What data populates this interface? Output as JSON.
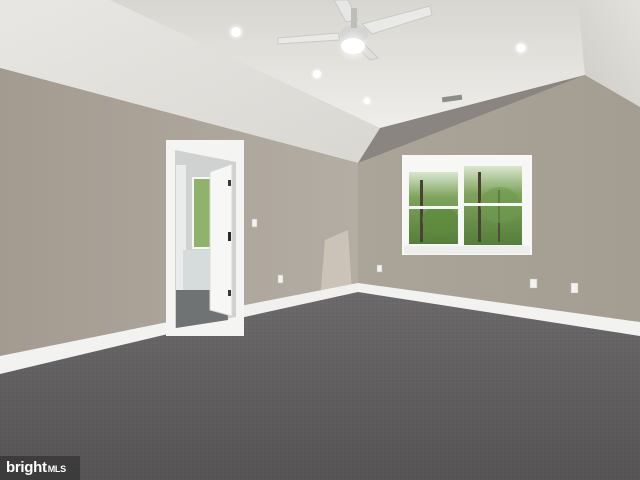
{
  "photo": {
    "subject": "empty room",
    "colors": {
      "wall_left": "#aea69c",
      "wall_right": "#a9a398",
      "ceiling": "#e4e2dd",
      "carpet": "#5e5c5d",
      "trim": "#f2f2f0",
      "window_view": "#6e9a4e"
    }
  },
  "watermark": {
    "brand": "bright",
    "suffix": "MLS"
  }
}
